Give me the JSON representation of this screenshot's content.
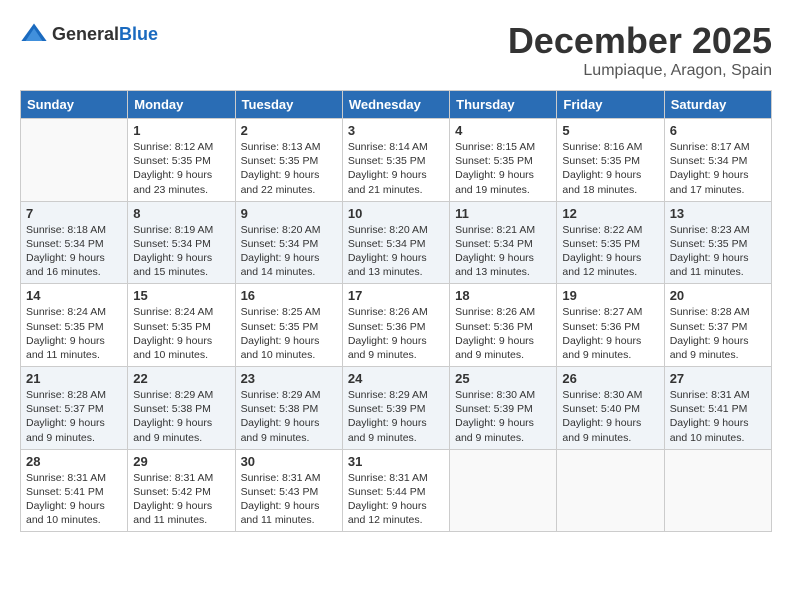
{
  "header": {
    "logo_general": "General",
    "logo_blue": "Blue",
    "month_title": "December 2025",
    "location": "Lumpiaque, Aragon, Spain"
  },
  "weekdays": [
    "Sunday",
    "Monday",
    "Tuesday",
    "Wednesday",
    "Thursday",
    "Friday",
    "Saturday"
  ],
  "weeks": [
    [
      {
        "day": "",
        "sunrise": "",
        "sunset": "",
        "daylight": ""
      },
      {
        "day": "1",
        "sunrise": "Sunrise: 8:12 AM",
        "sunset": "Sunset: 5:35 PM",
        "daylight": "Daylight: 9 hours and 23 minutes."
      },
      {
        "day": "2",
        "sunrise": "Sunrise: 8:13 AM",
        "sunset": "Sunset: 5:35 PM",
        "daylight": "Daylight: 9 hours and 22 minutes."
      },
      {
        "day": "3",
        "sunrise": "Sunrise: 8:14 AM",
        "sunset": "Sunset: 5:35 PM",
        "daylight": "Daylight: 9 hours and 21 minutes."
      },
      {
        "day": "4",
        "sunrise": "Sunrise: 8:15 AM",
        "sunset": "Sunset: 5:35 PM",
        "daylight": "Daylight: 9 hours and 19 minutes."
      },
      {
        "day": "5",
        "sunrise": "Sunrise: 8:16 AM",
        "sunset": "Sunset: 5:35 PM",
        "daylight": "Daylight: 9 hours and 18 minutes."
      },
      {
        "day": "6",
        "sunrise": "Sunrise: 8:17 AM",
        "sunset": "Sunset: 5:34 PM",
        "daylight": "Daylight: 9 hours and 17 minutes."
      }
    ],
    [
      {
        "day": "7",
        "sunrise": "Sunrise: 8:18 AM",
        "sunset": "Sunset: 5:34 PM",
        "daylight": "Daylight: 9 hours and 16 minutes."
      },
      {
        "day": "8",
        "sunrise": "Sunrise: 8:19 AM",
        "sunset": "Sunset: 5:34 PM",
        "daylight": "Daylight: 9 hours and 15 minutes."
      },
      {
        "day": "9",
        "sunrise": "Sunrise: 8:20 AM",
        "sunset": "Sunset: 5:34 PM",
        "daylight": "Daylight: 9 hours and 14 minutes."
      },
      {
        "day": "10",
        "sunrise": "Sunrise: 8:20 AM",
        "sunset": "Sunset: 5:34 PM",
        "daylight": "Daylight: 9 hours and 13 minutes."
      },
      {
        "day": "11",
        "sunrise": "Sunrise: 8:21 AM",
        "sunset": "Sunset: 5:34 PM",
        "daylight": "Daylight: 9 hours and 13 minutes."
      },
      {
        "day": "12",
        "sunrise": "Sunrise: 8:22 AM",
        "sunset": "Sunset: 5:35 PM",
        "daylight": "Daylight: 9 hours and 12 minutes."
      },
      {
        "day": "13",
        "sunrise": "Sunrise: 8:23 AM",
        "sunset": "Sunset: 5:35 PM",
        "daylight": "Daylight: 9 hours and 11 minutes."
      }
    ],
    [
      {
        "day": "14",
        "sunrise": "Sunrise: 8:24 AM",
        "sunset": "Sunset: 5:35 PM",
        "daylight": "Daylight: 9 hours and 11 minutes."
      },
      {
        "day": "15",
        "sunrise": "Sunrise: 8:24 AM",
        "sunset": "Sunset: 5:35 PM",
        "daylight": "Daylight: 9 hours and 10 minutes."
      },
      {
        "day": "16",
        "sunrise": "Sunrise: 8:25 AM",
        "sunset": "Sunset: 5:35 PM",
        "daylight": "Daylight: 9 hours and 10 minutes."
      },
      {
        "day": "17",
        "sunrise": "Sunrise: 8:26 AM",
        "sunset": "Sunset: 5:36 PM",
        "daylight": "Daylight: 9 hours and 9 minutes."
      },
      {
        "day": "18",
        "sunrise": "Sunrise: 8:26 AM",
        "sunset": "Sunset: 5:36 PM",
        "daylight": "Daylight: 9 hours and 9 minutes."
      },
      {
        "day": "19",
        "sunrise": "Sunrise: 8:27 AM",
        "sunset": "Sunset: 5:36 PM",
        "daylight": "Daylight: 9 hours and 9 minutes."
      },
      {
        "day": "20",
        "sunrise": "Sunrise: 8:28 AM",
        "sunset": "Sunset: 5:37 PM",
        "daylight": "Daylight: 9 hours and 9 minutes."
      }
    ],
    [
      {
        "day": "21",
        "sunrise": "Sunrise: 8:28 AM",
        "sunset": "Sunset: 5:37 PM",
        "daylight": "Daylight: 9 hours and 9 minutes."
      },
      {
        "day": "22",
        "sunrise": "Sunrise: 8:29 AM",
        "sunset": "Sunset: 5:38 PM",
        "daylight": "Daylight: 9 hours and 9 minutes."
      },
      {
        "day": "23",
        "sunrise": "Sunrise: 8:29 AM",
        "sunset": "Sunset: 5:38 PM",
        "daylight": "Daylight: 9 hours and 9 minutes."
      },
      {
        "day": "24",
        "sunrise": "Sunrise: 8:29 AM",
        "sunset": "Sunset: 5:39 PM",
        "daylight": "Daylight: 9 hours and 9 minutes."
      },
      {
        "day": "25",
        "sunrise": "Sunrise: 8:30 AM",
        "sunset": "Sunset: 5:39 PM",
        "daylight": "Daylight: 9 hours and 9 minutes."
      },
      {
        "day": "26",
        "sunrise": "Sunrise: 8:30 AM",
        "sunset": "Sunset: 5:40 PM",
        "daylight": "Daylight: 9 hours and 9 minutes."
      },
      {
        "day": "27",
        "sunrise": "Sunrise: 8:31 AM",
        "sunset": "Sunset: 5:41 PM",
        "daylight": "Daylight: 9 hours and 10 minutes."
      }
    ],
    [
      {
        "day": "28",
        "sunrise": "Sunrise: 8:31 AM",
        "sunset": "Sunset: 5:41 PM",
        "daylight": "Daylight: 9 hours and 10 minutes."
      },
      {
        "day": "29",
        "sunrise": "Sunrise: 8:31 AM",
        "sunset": "Sunset: 5:42 PM",
        "daylight": "Daylight: 9 hours and 11 minutes."
      },
      {
        "day": "30",
        "sunrise": "Sunrise: 8:31 AM",
        "sunset": "Sunset: 5:43 PM",
        "daylight": "Daylight: 9 hours and 11 minutes."
      },
      {
        "day": "31",
        "sunrise": "Sunrise: 8:31 AM",
        "sunset": "Sunset: 5:44 PM",
        "daylight": "Daylight: 9 hours and 12 minutes."
      },
      {
        "day": "",
        "sunrise": "",
        "sunset": "",
        "daylight": ""
      },
      {
        "day": "",
        "sunrise": "",
        "sunset": "",
        "daylight": ""
      },
      {
        "day": "",
        "sunrise": "",
        "sunset": "",
        "daylight": ""
      }
    ]
  ]
}
